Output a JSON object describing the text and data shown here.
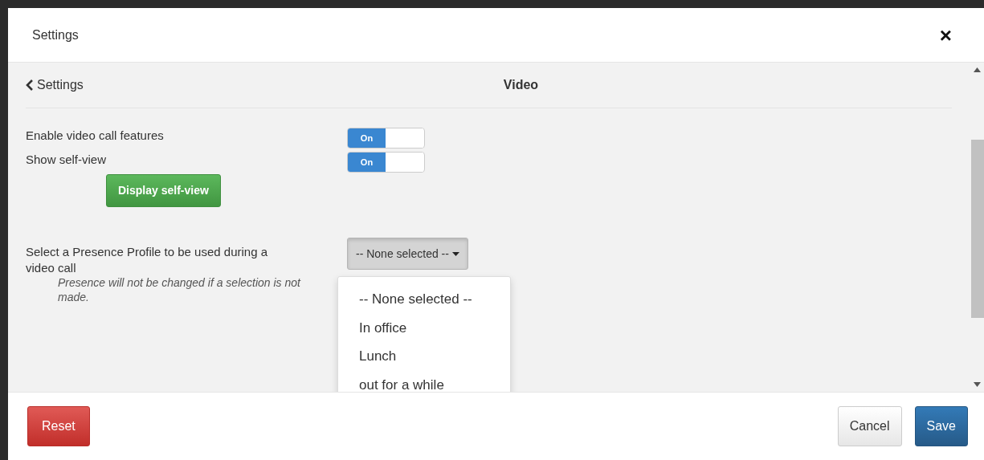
{
  "modal": {
    "title": "Settings",
    "close": "×"
  },
  "subheader": {
    "back": "Settings",
    "title": "Video"
  },
  "settings": [
    {
      "kind": "toggle",
      "label": "Enable video call features",
      "on": true,
      "on_text": "On"
    },
    {
      "kind": "toggle",
      "label": "Show self-view",
      "on": true,
      "on_text": "On",
      "action": "Display self-view"
    },
    {
      "kind": "select",
      "label": "Select a Presence Profile to be used during a video call",
      "hint": "Presence will not be changed if a selection is not made.",
      "value": "-- None selected --",
      "expanded": true,
      "options": [
        "-- None selected --",
        "In office",
        "Lunch",
        "out for a while"
      ]
    }
  ],
  "footer": {
    "reset": "Reset",
    "cancel": "Cancel",
    "save": "Save"
  }
}
